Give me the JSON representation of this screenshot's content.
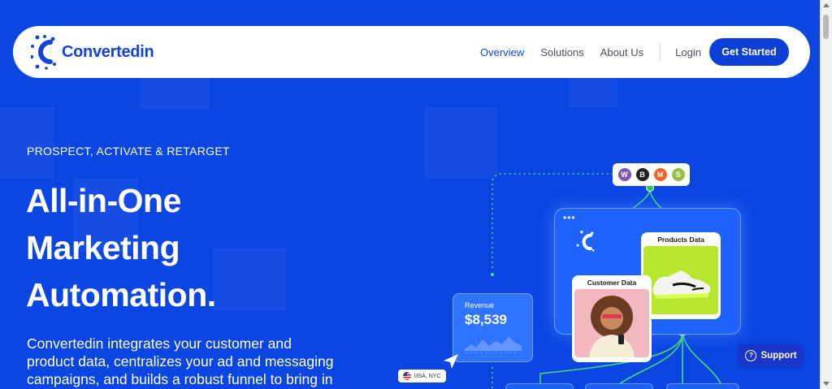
{
  "brand": {
    "name": "Convertedin"
  },
  "nav": {
    "links": [
      {
        "label": "Overview"
      },
      {
        "label": "Solutions"
      },
      {
        "label": "About Us"
      }
    ],
    "login": "Login",
    "cta": "Get Started"
  },
  "hero": {
    "eyebrow": "PROSPECT, ACTIVATE & RETARGET",
    "headline_lines": [
      "All-in-One",
      "Marketing",
      "Automation."
    ],
    "subcopy_lines": [
      "Convertedin integrates your customer and",
      "product data, centralizes your ad and messaging",
      "campaigns, and builds a robust funnel to bring in"
    ]
  },
  "graphic": {
    "integrations": [
      "woocommerce-icon",
      "bigcommerce-icon",
      "magento-icon",
      "shopify-icon"
    ],
    "products_title": "Products Data",
    "customer_title": "Customer Data",
    "revenue_label": "Revenue",
    "revenue_value": "$8,539",
    "location": "USA, NYC"
  },
  "support": {
    "label": "Support"
  },
  "colors": {
    "primary": "#0b46e3",
    "brand_blue": "#1344d6",
    "cta_blue": "#0d3fd6",
    "product_green": "#b7e62e"
  }
}
